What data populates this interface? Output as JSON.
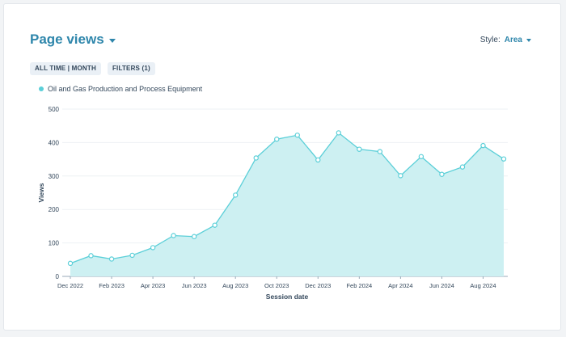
{
  "header": {
    "title": "Page views"
  },
  "style_selector": {
    "label": "Style:",
    "value": "Area"
  },
  "filters": {
    "time_range": "ALL TIME | MONTH",
    "filters_label": "FILTERS (1)"
  },
  "legend": {
    "series_name": "Oil and Gas Production and Process Equipment"
  },
  "colors": {
    "accent": "#2e86ab",
    "series_line": "#5bcfd8",
    "series_fill": "#cdf0f2"
  },
  "icons": {
    "title_dropdown": "chevron-down-icon",
    "style_dropdown": "chevron-down-icon"
  },
  "chart_data": {
    "type": "area",
    "xlabel": "Session date",
    "ylabel": "Views",
    "ylim": [
      0,
      500
    ],
    "y_ticks": [
      "0",
      "100",
      "200",
      "300",
      "400",
      "500"
    ],
    "x_ticks": [
      "Dec 2022",
      "Feb 2023",
      "Apr 2023",
      "Jun 2023",
      "Aug 2023",
      "Oct 2023",
      "Dec 2023",
      "Feb 2024",
      "Apr 2024",
      "Jun 2024",
      "Aug 2024"
    ],
    "grid": true,
    "legend_position": "top-left",
    "x": [
      "2022-12",
      "2023-01",
      "2023-02",
      "2023-03",
      "2023-04",
      "2023-05",
      "2023-06",
      "2023-07",
      "2023-08",
      "2023-09",
      "2023-10",
      "2023-11",
      "2023-12",
      "2024-01",
      "2024-02",
      "2024-03",
      "2024-04",
      "2024-05",
      "2024-06",
      "2024-07",
      "2024-08",
      "2024-09"
    ],
    "series": [
      {
        "name": "Oil and Gas Production and Process Equipment",
        "values": [
          39,
          62,
          52,
          63,
          86,
          122,
          119,
          153,
          243,
          354,
          410,
          422,
          348,
          429,
          380,
          373,
          301,
          358,
          305,
          327,
          391,
          351
        ]
      }
    ]
  }
}
